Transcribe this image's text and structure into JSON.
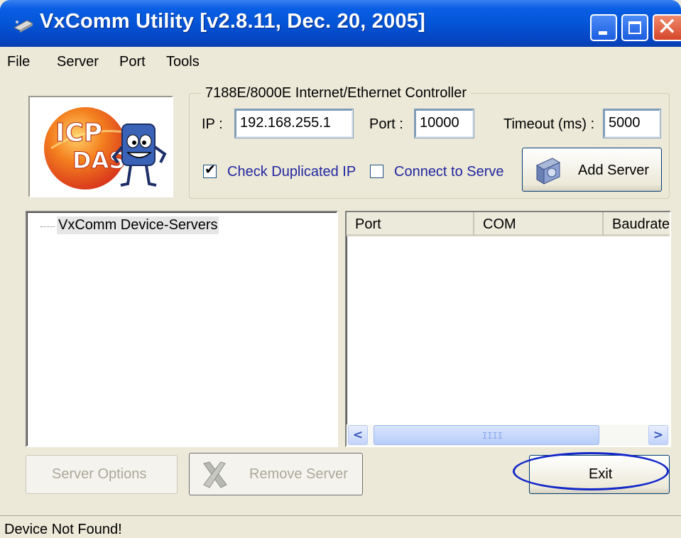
{
  "window": {
    "title": "VxComm Utility [v2.8.11, Dec. 20, 2005]"
  },
  "menu": [
    "File",
    "Server",
    "Port",
    "Tools"
  ],
  "logo": {
    "text_top": "ICP",
    "text_bottom": "DAS"
  },
  "controller": {
    "legend": "7188E/8000E Internet/Ethernet Controller",
    "ip_label": "IP :",
    "ip_value": "192.168.255.1",
    "port_label": "Port :",
    "port_value": "10000",
    "timeout_label": "Timeout (ms) :",
    "timeout_value": "5000",
    "check_duplicated_label": "Check Duplicated IP",
    "check_duplicated_checked": true,
    "connect_label": "Connect to Serve",
    "connect_checked": false,
    "add_server_label": "Add Server"
  },
  "tree": {
    "root_label": "VxComm Device-Servers"
  },
  "list": {
    "columns": [
      "Port",
      "COM",
      "Baudrate"
    ]
  },
  "buttons": {
    "server_options": "Server Options",
    "remove_server": "Remove Server",
    "exit": "Exit"
  },
  "status": {
    "text": "Device Not Found!"
  },
  "colors": {
    "titlebar": "#0453d4",
    "highlight": "#1227c9",
    "checkbox_label": "#2226a0"
  }
}
